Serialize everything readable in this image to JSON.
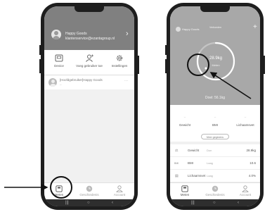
{
  "left_screen": {
    "header": {
      "name": "Happy Goods",
      "email": "klantenservice@ezantagroup.nl",
      "chevron": "›"
    },
    "toolbar": {
      "device": "Device",
      "add_user": "Voeg gebruiker toe",
      "settings": "Instellingen"
    },
    "user_row": {
      "text": "[Hoofdgebruiker]Happy Goods",
      "subtext": "--",
      "dots": "···"
    },
    "tabs": {
      "measure": "Meten",
      "history": "Geschiedenis",
      "account": "Account"
    }
  },
  "right_screen": {
    "header": {
      "name": "Happy Goods",
      "middle": "Verbonden",
      "plus": "+"
    },
    "ring": {
      "weight": "28.9kg",
      "status": "Meten",
      "progress": 0.82
    },
    "goal": "Doel: 56.1kg",
    "stats": [
      {
        "label": "Gewicht",
        "value": "--"
      },
      {
        "label": "BMI",
        "value": "--"
      },
      {
        "label": "Lichaamsvet",
        "value": "--"
      }
    ],
    "more_button": "Meer gegevens",
    "list": [
      {
        "icon": "⚖",
        "name": "Gewicht",
        "status": "Dun",
        "value": "28.9kg"
      },
      {
        "icon": "BMI",
        "name": "BMI",
        "status": "Laag",
        "value": "10.6"
      },
      {
        "icon": "▤",
        "name": "Lichaamsvet",
        "status": "Laag",
        "value": "4.0%"
      }
    ],
    "tabs": {
      "measure": "Meten",
      "history": "Geschiedenis",
      "account": "Account"
    }
  },
  "system_bar": {
    "menu": "|||",
    "home": "○",
    "back": "‹"
  },
  "colors": {
    "header_gray": "#808080",
    "ring_bg": "#a8a8a8",
    "frame": "#1e1e1e"
  }
}
